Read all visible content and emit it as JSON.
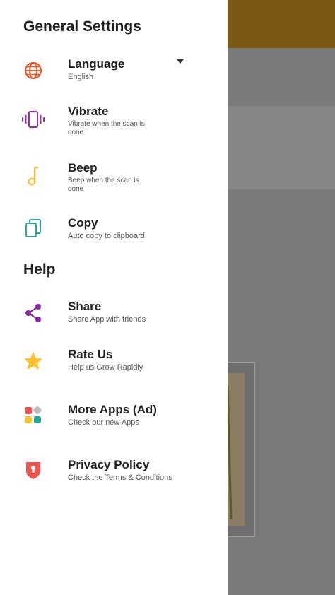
{
  "colors": {
    "toolbar": "#7d5a14",
    "scrim": "#7b7b7b",
    "drawer_bg": "#ffffff",
    "language_icon": "#f4511e",
    "vibrate_icon": "#9c27b0",
    "beep_icon": "#fbc02d",
    "copy_icon": "#26a69a",
    "share_icon": "#8e24aa",
    "rate_icon": "#fbc02d",
    "privacy_icon": "#ef5350"
  },
  "drawer": {
    "general_title": "General Settings",
    "help_title": "Help",
    "general_items": [
      {
        "icon": "globe-icon",
        "title": "Language",
        "subtitle": "English"
      },
      {
        "icon": "vibrate-icon",
        "title": "Vibrate",
        "subtitle": "Vibrate when the scan is done"
      },
      {
        "icon": "music-note-icon",
        "title": "Beep",
        "subtitle": "Beep when the scan is done"
      },
      {
        "icon": "copy-icon",
        "title": "Copy",
        "subtitle": "Auto copy to clipboard"
      }
    ],
    "help_items": [
      {
        "icon": "share-icon",
        "title": "Share",
        "subtitle": "Share App with friends"
      },
      {
        "icon": "star-icon",
        "title": "Rate Us",
        "subtitle": "Help us Grow Rapidly"
      },
      {
        "icon": "apps-grid-icon",
        "title": "More Apps (Ad)",
        "subtitle": "Check our new Apps"
      },
      {
        "icon": "privacy-shield-icon",
        "title": "Privacy Policy",
        "subtitle": "Check the Terms & Conditions"
      }
    ]
  }
}
